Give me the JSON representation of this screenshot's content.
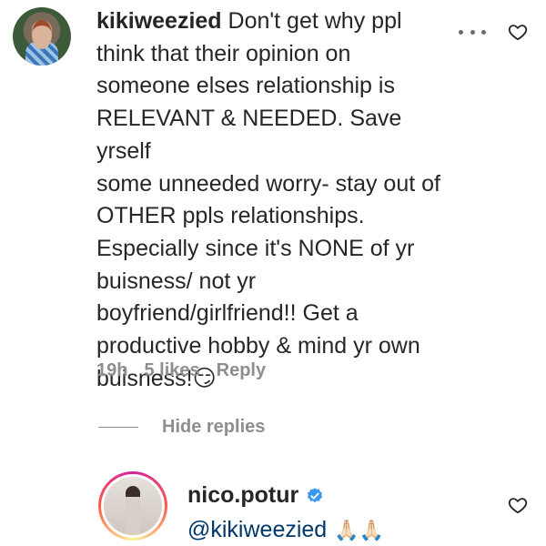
{
  "comment": {
    "username": "kikiweezied",
    "text": "Don't get why ppl\nthink that their opinion on\nsomeone elses relationship is\nRELEVANT & NEEDED. Save yrself\nsome unneeded worry- stay out of\nOTHER ppls relationships.\nEspecially since it's NONE of yr\nbuisness/ not yr\nboyfriend/girlfriend!! Get a\nproductive hobby & mind yr own\nbuisness!",
    "emoji": "😏",
    "time": "19h",
    "likes": "5 likes",
    "reply_label": "Reply",
    "more_icon": "more-horizontal-icon",
    "like_icon": "heart-outline-icon"
  },
  "replies": {
    "toggle_label": "Hide replies"
  },
  "reply": {
    "username": "nico.potur",
    "mention": "@kikiweezied",
    "emoji": "🙏🏻🙏🏻",
    "verified_icon": "verified-badge-icon",
    "like_icon": "heart-outline-icon"
  },
  "colors": {
    "text": "#262626",
    "muted": "#8e8e8e",
    "mention": "#00376b",
    "verified": "#3897f0"
  }
}
